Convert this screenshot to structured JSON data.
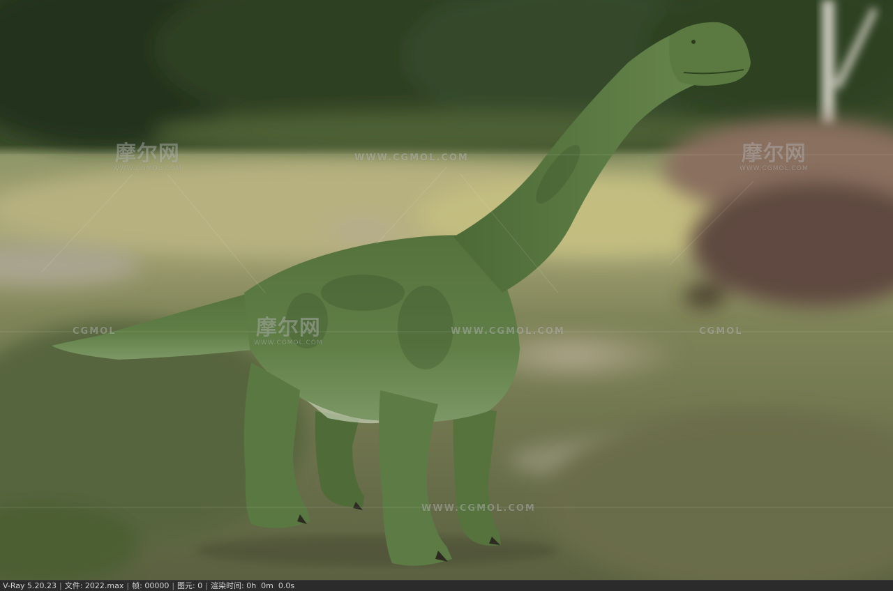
{
  "watermark": {
    "logo_cn": "摩尔网",
    "logo_url": "WWW.CGMOL.COM",
    "site_url": "WWW.CGMOL.COM",
    "brand": "CGMOL"
  },
  "status_bar": {
    "renderer": "V-Ray 5.20.23",
    "file_label": "文件:",
    "file_value": "2022.max",
    "frame_label": "帧:",
    "frame_value": "00000",
    "primitives_label": "图元:",
    "primitives_value": "0",
    "render_time_label": "渲染时间:",
    "render_time_value": "0h  0m  0.0s"
  },
  "colors": {
    "dino_base": "#5d7a44",
    "dino_shadow": "#3e5a2c",
    "dino_belly": "#8aa27a",
    "status_bg": "#2b2b2b"
  },
  "icons": {
    "subject": "brachiosaurus-model"
  }
}
